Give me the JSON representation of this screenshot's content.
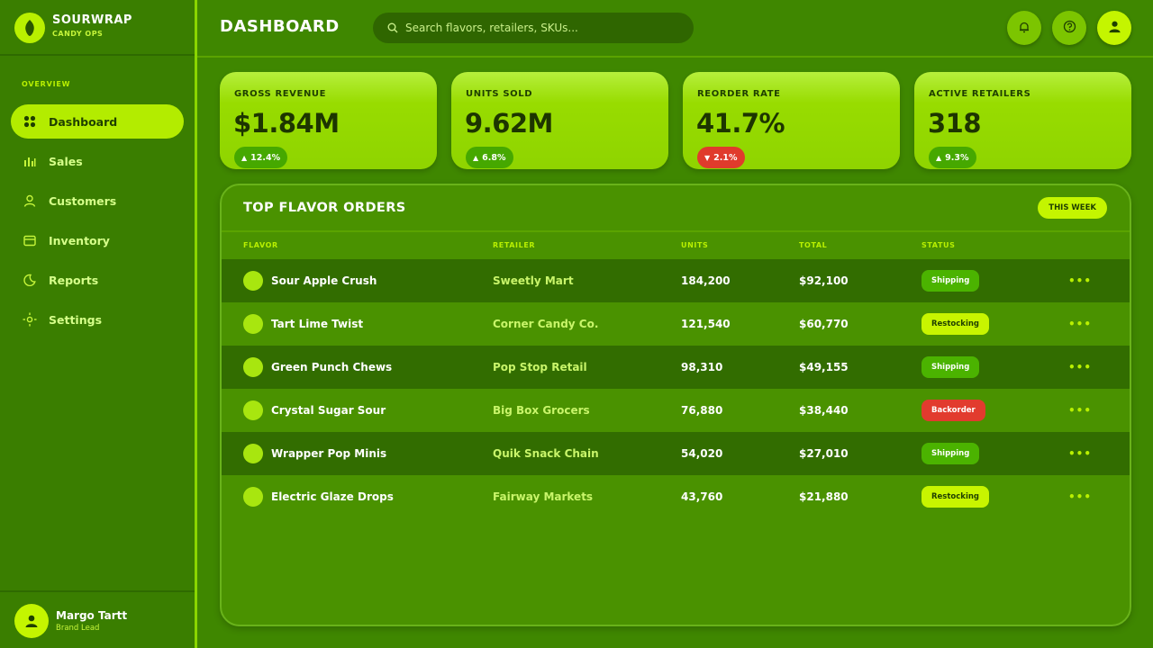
{
  "brand": {
    "name": "SOURWRAP",
    "subtitle": "CANDY OPS"
  },
  "sidebar": {
    "section_label": "OVERVIEW",
    "items": [
      {
        "label": "Dashboard",
        "icon": "grid-icon",
        "active": true
      },
      {
        "label": "Sales",
        "icon": "bar-chart-icon",
        "active": false
      },
      {
        "label": "Customers",
        "icon": "user-icon",
        "active": false
      },
      {
        "label": "Inventory",
        "icon": "box-icon",
        "active": false
      },
      {
        "label": "Reports",
        "icon": "moon-icon",
        "active": false
      },
      {
        "label": "Settings",
        "icon": "gear-icon",
        "active": false
      }
    ],
    "user": {
      "name": "Margo Tartt",
      "role": "Brand Lead"
    }
  },
  "header": {
    "title": "DASHBOARD",
    "search_placeholder": "Search flavors, retailers, SKUs..."
  },
  "kpis": [
    {
      "label": "GROSS REVENUE",
      "value": "$1.84M",
      "change": "12.4%",
      "direction": "up"
    },
    {
      "label": "UNITS SOLD",
      "value": "9.62M",
      "change": "6.8%",
      "direction": "up"
    },
    {
      "label": "REORDER RATE",
      "value": "41.7%",
      "change": "2.1%",
      "direction": "down"
    },
    {
      "label": "ACTIVE RETAILERS",
      "value": "318",
      "change": "9.3%",
      "direction": "up"
    }
  ],
  "orders": {
    "title": "TOP FLAVOR ORDERS",
    "period": "THIS WEEK",
    "columns": [
      "FLAVOR",
      "RETAILER",
      "UNITS",
      "TOTAL",
      "STATUS"
    ],
    "rows": [
      {
        "flavor": "Sour Apple Crush",
        "retailer": "Sweetly Mart",
        "units": "184,200",
        "total": "$92,100",
        "status": "Shipping"
      },
      {
        "flavor": "Tart Lime Twist",
        "retailer": "Corner Candy Co.",
        "units": "121,540",
        "total": "$60,770",
        "status": "Restocking"
      },
      {
        "flavor": "Green Punch Chews",
        "retailer": "Pop Stop Retail",
        "units": "98,310",
        "total": "$49,155",
        "status": "Shipping"
      },
      {
        "flavor": "Crystal Sugar Sour",
        "retailer": "Big Box Grocers",
        "units": "76,880",
        "total": "$38,440",
        "status": "Backorder"
      },
      {
        "flavor": "Wrapper Pop Minis",
        "retailer": "Quik Snack Chain",
        "units": "54,020",
        "total": "$27,010",
        "status": "Shipping"
      },
      {
        "flavor": "Electric Glaze Drops",
        "retailer": "Fairway Markets",
        "units": "43,760",
        "total": "$21,880",
        "status": "Restocking"
      }
    ]
  },
  "colors": {
    "background": "#3f8700",
    "accent": "#c4f500",
    "status_shipping": "#4bb300",
    "status_restocking": "#c8f500",
    "status_backorder": "#e23b2e"
  }
}
